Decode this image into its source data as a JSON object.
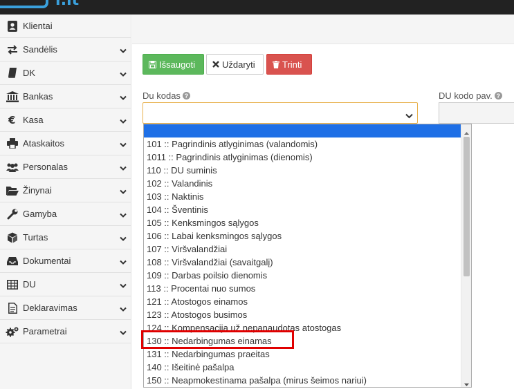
{
  "logo": {
    "text": "r.lt"
  },
  "sidebar": {
    "items": [
      {
        "label": "Klientai",
        "icon": "contact-card-icon",
        "chevron": false
      },
      {
        "label": "Sandėlis",
        "icon": "exchange-arrows-icon",
        "chevron": true
      },
      {
        "label": "DK",
        "icon": "book-icon",
        "chevron": true
      },
      {
        "label": "Bankas",
        "icon": "bank-icon",
        "chevron": true
      },
      {
        "label": "Kasa",
        "icon": "euro-icon",
        "chevron": true
      },
      {
        "label": "Ataskaitos",
        "icon": "printer-icon",
        "chevron": true
      },
      {
        "label": "Personalas",
        "icon": "users-icon",
        "chevron": true
      },
      {
        "label": "Žinynai",
        "icon": "folder-open-icon",
        "chevron": true
      },
      {
        "label": "Gamyba",
        "icon": "wrench-icon",
        "chevron": true
      },
      {
        "label": "Turtas",
        "icon": "cube-icon",
        "chevron": true
      },
      {
        "label": "Dokumentai",
        "icon": "inbox-icon",
        "chevron": true
      },
      {
        "label": "DU",
        "icon": "table-icon",
        "chevron": true
      },
      {
        "label": "Deklaravimas",
        "icon": "document-icon",
        "chevron": true
      },
      {
        "label": "Parametrai",
        "icon": "gears-icon",
        "chevron": true
      }
    ]
  },
  "toolbar": {
    "save_label": "Išsaugoti",
    "close_label": "Uždaryti",
    "delete_label": "Trinti"
  },
  "form": {
    "du_kodas_label": "Du kodas",
    "du_kodo_pav_label": "DU kodo pav."
  },
  "dropdown": {
    "selected_option": "",
    "options": [
      "",
      "101 :: Pagrindinis atlyginimas (valandomis)",
      "1011 :: Pagrindinis atlyginimas (dienomis)",
      "110 :: DU suminis",
      "102 :: Valandinis",
      "103 :: Naktinis",
      "104 :: Šventinis",
      "105 :: Kenksmingos sąlygos",
      "106 :: Labai kenksmingos sąlygos",
      "107 :: Viršvalandžiai",
      "108 :: Viršvalandžiai (savaitgalį)",
      "109 :: Darbas poilsio dienomis",
      "113 :: Procentai nuo sumos",
      "121 :: Atostogos einamos",
      "123 :: Atostogos busimos",
      "124 :: Kompensacija už nepanaudotas atostogas",
      "130 :: Nedarbingumas einamas",
      "131 :: Nedarbingumas praeitas",
      "140 :: Išeitinė pašalpa",
      "150 :: Neapmokestinama pašalpa (mirus šeimos nariui)"
    ]
  },
  "colors": {
    "save": "#5cb85c",
    "delete": "#d9534f",
    "selected_option": "#1e6fe6",
    "highlight_box": "#e00000",
    "focus_border": "#e8b04b"
  }
}
